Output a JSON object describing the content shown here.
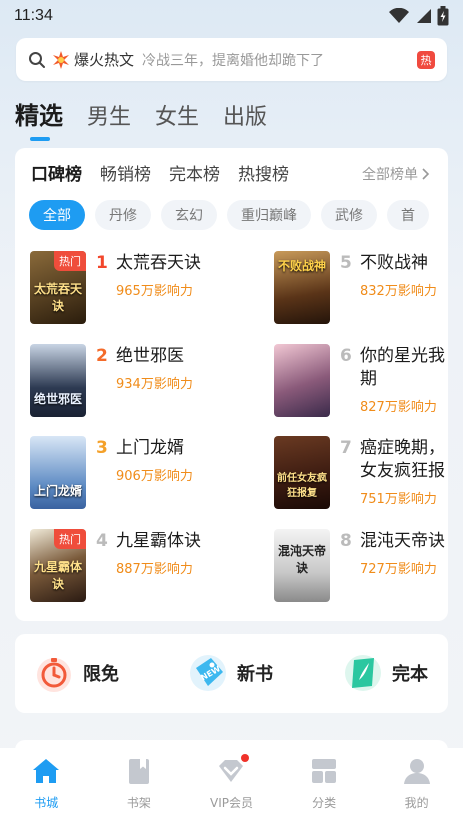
{
  "status_bar": {
    "time": "11:34"
  },
  "search": {
    "hot_word": "爆火热文",
    "hint": "冷战三年，提离婚他却跪下了",
    "hot_tag": "热"
  },
  "top_tabs": [
    {
      "label": "精选",
      "active": true
    },
    {
      "label": "男生"
    },
    {
      "label": "女生"
    },
    {
      "label": "出版"
    }
  ],
  "rank_tabs": [
    {
      "label": "口碑榜",
      "active": true
    },
    {
      "label": "畅销榜"
    },
    {
      "label": "完本榜"
    },
    {
      "label": "热搜榜"
    }
  ],
  "all_rank_label": "全部榜单",
  "chips": [
    "全部",
    "丹修",
    "玄幻",
    "重归巅峰",
    "武修",
    "首"
  ],
  "books": [
    {
      "rank": "1",
      "title": "太荒吞天诀",
      "influence": "965万影响力",
      "badge": "热门",
      "cover_text": "太荒吞天诀",
      "cover_color": "#3b2a14"
    },
    {
      "rank": "2",
      "title": "绝世邪医",
      "influence": "934万影响力",
      "badge": "",
      "cover_text": "绝世邪医",
      "cover_color": "#2d3a52"
    },
    {
      "rank": "3",
      "title": "上门龙婿",
      "influence": "906万影响力",
      "badge": "",
      "cover_text": "上门龙婿",
      "cover_color": "#5b89c2"
    },
    {
      "rank": "4",
      "title": "九星霸体诀",
      "influence": "887万影响力",
      "badge": "热门",
      "cover_text": "九星霸体诀",
      "cover_color": "#3a2a22"
    },
    {
      "rank": "5",
      "title": "不败战神",
      "influence": "832万影响力",
      "badge": "",
      "cover_text": "不败战神",
      "cover_color": "#3a2418"
    },
    {
      "rank": "6",
      "title_line1": "你的星光我",
      "title_line2": "期",
      "influence": "827万影响力",
      "badge": "",
      "cover_text": "",
      "cover_color": "#8a5a7a"
    },
    {
      "rank": "7",
      "title_line1": "癌症晚期，",
      "title_line2": "女友疯狂报",
      "influence": "751万影响力",
      "badge": "",
      "cover_text": "前任女友疯狂报复",
      "cover_color": "#4a2418"
    },
    {
      "rank": "8",
      "title": "混沌天帝诀",
      "influence": "727万影响力",
      "badge": "",
      "cover_text": "混沌天帝诀",
      "cover_color": "#d8d8d8"
    }
  ],
  "quick_entries": [
    {
      "label": "限免",
      "icon": "stopwatch-icon"
    },
    {
      "label": "新书",
      "icon": "new-tag-icon"
    },
    {
      "label": "完本",
      "icon": "feather-book-icon"
    }
  ],
  "bottom_nav": [
    {
      "label": "书城",
      "icon": "home-icon",
      "active": true
    },
    {
      "label": "书架",
      "icon": "bookmark-icon"
    },
    {
      "label": "VIP会员",
      "icon": "vip-diamond-icon",
      "dot": true
    },
    {
      "label": "分类",
      "icon": "category-icon"
    },
    {
      "label": "我的",
      "icon": "profile-icon"
    }
  ],
  "colors": {
    "accent": "#1e9cf2",
    "rank1": "#f2472c",
    "influence": "#f08c1a"
  }
}
